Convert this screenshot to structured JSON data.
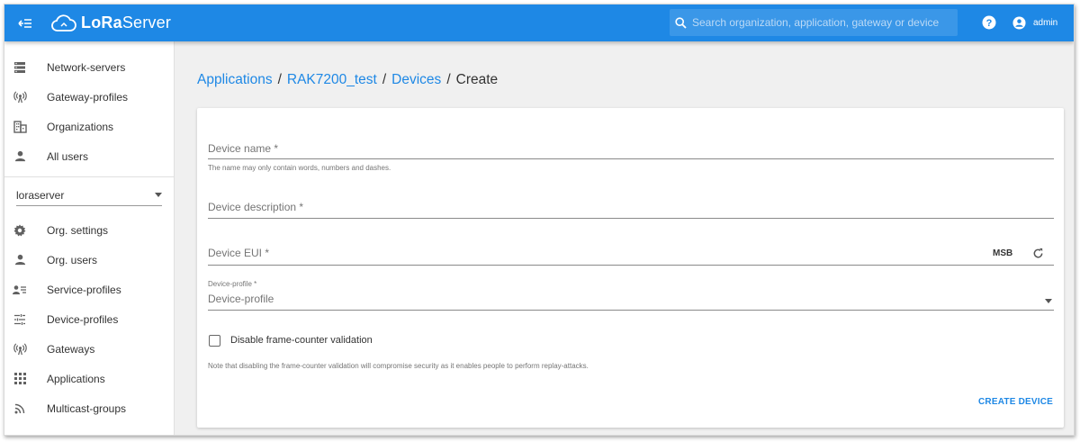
{
  "app": {
    "logo_text_bold": "LoRa",
    "logo_text_rest": "Server",
    "search_placeholder": "Search organization, application, gateway or device",
    "user_name": "admin",
    "accent_color": "#1e88e5"
  },
  "sidebar": {
    "top_items": [
      {
        "label": "Network-servers",
        "icon": "server-icon"
      },
      {
        "label": "Gateway-profiles",
        "icon": "broadcast-icon"
      },
      {
        "label": "Organizations",
        "icon": "building-icon"
      },
      {
        "label": "All users",
        "icon": "person-icon"
      }
    ],
    "org_select_value": "loraserver",
    "org_items": [
      {
        "label": "Org. settings",
        "icon": "gear-icon"
      },
      {
        "label": "Org. users",
        "icon": "person-icon"
      },
      {
        "label": "Service-profiles",
        "icon": "account-details-icon"
      },
      {
        "label": "Device-profiles",
        "icon": "tune-icon"
      },
      {
        "label": "Gateways",
        "icon": "broadcast-icon"
      },
      {
        "label": "Applications",
        "icon": "apps-grid-icon"
      },
      {
        "label": "Multicast-groups",
        "icon": "rss-icon"
      }
    ]
  },
  "breadcrumb": {
    "items": [
      "Applications",
      "RAK7200_test",
      "Devices"
    ],
    "separator": "/",
    "current": "Create"
  },
  "form": {
    "device_name_placeholder": "Device name *",
    "device_name_helper": "The name may only contain words, numbers and dashes.",
    "device_description_placeholder": "Device description *",
    "device_eui_placeholder": "Device EUI *",
    "msb_label": "MSB",
    "device_profile_label": "Device-profile *",
    "device_profile_placeholder": "Device-profile",
    "disable_fcnt_label": "Disable frame-counter validation",
    "disable_fcnt_note": "Note that disabling the frame-counter validation will compromise security as it enables people to perform replay-attacks.",
    "submit_label": "CREATE DEVICE"
  }
}
